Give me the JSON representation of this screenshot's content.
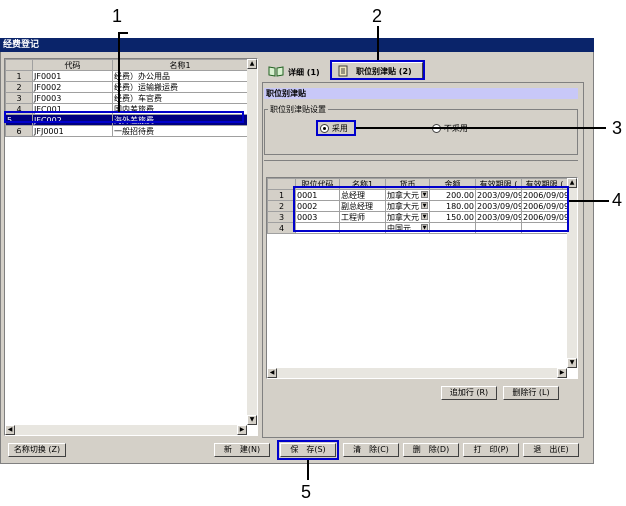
{
  "window": {
    "title": "经费登记"
  },
  "left_grid": {
    "headers": [
      "代码",
      "名称1"
    ],
    "rows": [
      {
        "n": "1",
        "code": "JF0001",
        "name": "经费）办公用品"
      },
      {
        "n": "2",
        "code": "JF0002",
        "name": "经费）运输搬运费"
      },
      {
        "n": "3",
        "code": "JF0003",
        "name": "经费）车官费"
      },
      {
        "n": "4",
        "code": "JFC001",
        "name": "国内差旅费"
      },
      {
        "n": "5",
        "code": "JFC002",
        "name": "海外差旅费"
      },
      {
        "n": "6",
        "code": "JFJ0001",
        "name": "一般招待费"
      }
    ],
    "selected_row": "5"
  },
  "tabs": [
    {
      "label": "详细 (1)"
    },
    {
      "label": "职位别津贴 (2)"
    }
  ],
  "panel": {
    "header": "职位别津贴",
    "group_label": "职位别津贴设置",
    "radio_adopt": "采用",
    "radio_not_adopt": "不采用"
  },
  "right_grid": {
    "headers": [
      "职位代码",
      "名称1",
      "货币",
      "金额",
      "有效期限 (",
      "有效期限 ("
    ],
    "rows": [
      {
        "n": "1",
        "code": "0001",
        "name": "总经理",
        "currency": "加拿大元",
        "amount": "200.00",
        "from": "2003/09/09",
        "to": "2006/09/09"
      },
      {
        "n": "2",
        "code": "0002",
        "name": "副总经理",
        "currency": "加拿大元",
        "amount": "180.00",
        "from": "2003/09/09",
        "to": "2006/09/09"
      },
      {
        "n": "3",
        "code": "0003",
        "name": "工程师",
        "currency": "加拿大元",
        "amount": "150.00",
        "from": "2003/09/09",
        "to": "2006/09/09"
      },
      {
        "n": "4",
        "code": "",
        "name": "",
        "currency": "中国元",
        "amount": "",
        "from": "",
        "to": ""
      }
    ]
  },
  "grid_buttons": {
    "add_row": "追加行 (R)",
    "delete_row": "删除行 (L)"
  },
  "bottom_buttons": {
    "name_switch": "名称切换 (Z)",
    "new": "新　建(N)",
    "save": "保　存(S)",
    "clear": "清　除(C)",
    "delete": "删　除(D)",
    "print": "打　印(P)",
    "exit": "退　出(E)"
  },
  "callouts": [
    "1",
    "2",
    "3",
    "4",
    "5"
  ],
  "colors": {
    "title_bar": "#0a246a",
    "selected_row": "#000080",
    "callout_box": "#0000cc",
    "panel_header": "#c8c8f8"
  },
  "icons": [
    "book-icon",
    "document-icon"
  ]
}
